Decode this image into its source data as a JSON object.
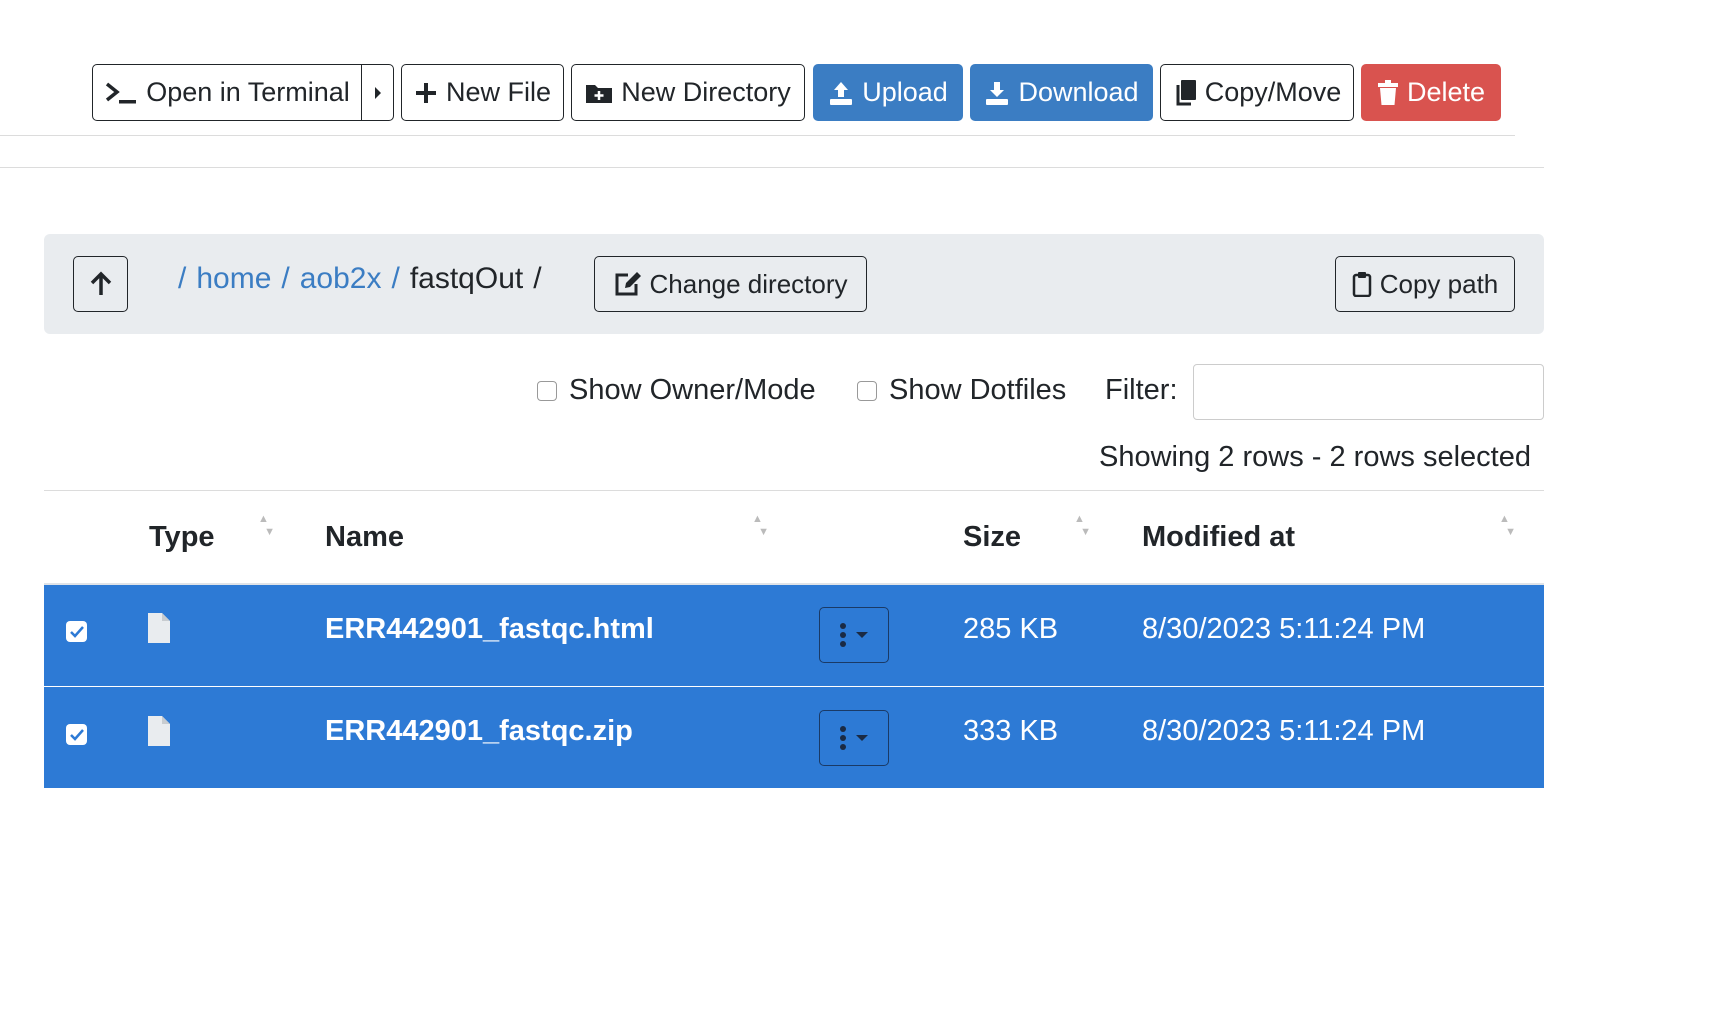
{
  "toolbar": {
    "open_terminal": "Open in Terminal",
    "new_file": "New File",
    "new_directory": "New Directory",
    "upload": "Upload",
    "download": "Download",
    "copy_move": "Copy/Move",
    "delete": "Delete"
  },
  "breadcrumb": {
    "separator": "/",
    "items": [
      "home",
      "aob2x"
    ],
    "current": "fastqOut"
  },
  "pathbar": {
    "change_directory": "Change directory",
    "copy_path": "Copy path"
  },
  "options": {
    "show_owner_mode": "Show Owner/Mode",
    "show_dotfiles": "Show Dotfiles",
    "filter_label": "Filter:",
    "filter_value": ""
  },
  "status": "Showing 2 rows - 2 rows selected",
  "table": {
    "headers": [
      "Type",
      "Name",
      "Size",
      "Modified at"
    ],
    "rows": [
      {
        "name": "ERR442901_fastqc.html",
        "size": "285 KB",
        "modified": "8/30/2023 5:11:24 PM",
        "selected": true
      },
      {
        "name": "ERR442901_fastqc.zip",
        "size": "333 KB",
        "modified": "8/30/2023 5:11:24 PM",
        "selected": true
      }
    ]
  },
  "colors": {
    "primary": "#3b7dc3",
    "danger": "#d9534f",
    "selected_row": "#2d7ad5",
    "link": "#3b7dc3"
  }
}
